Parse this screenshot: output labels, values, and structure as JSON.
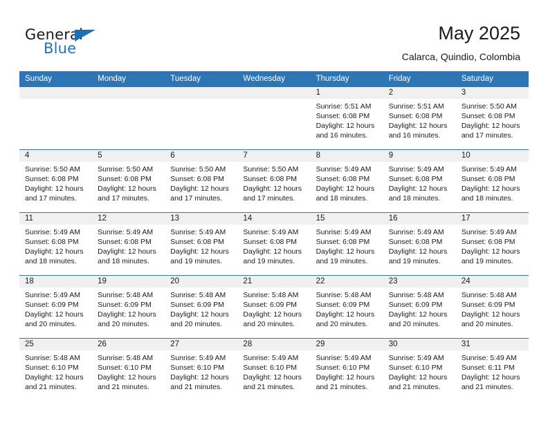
{
  "brand": {
    "name_top": "General",
    "name_bottom": "Blue",
    "accent_color": "#2272b8"
  },
  "header": {
    "title": "May 2025",
    "location": "Calarca, Quindio, Colombia"
  },
  "calendar": {
    "header_bg": "#2e75b6",
    "daynum_bg": "#f0f0f0",
    "weekday_headers": [
      "Sunday",
      "Monday",
      "Tuesday",
      "Wednesday",
      "Thursday",
      "Friday",
      "Saturday"
    ],
    "weeks": [
      [
        {
          "day": "",
          "empty": true
        },
        {
          "day": "",
          "empty": true
        },
        {
          "day": "",
          "empty": true
        },
        {
          "day": "",
          "empty": true
        },
        {
          "day": "1",
          "sunrise": "Sunrise: 5:51 AM",
          "sunset": "Sunset: 6:08 PM",
          "daylight": "Daylight: 12 hours and 16 minutes."
        },
        {
          "day": "2",
          "sunrise": "Sunrise: 5:51 AM",
          "sunset": "Sunset: 6:08 PM",
          "daylight": "Daylight: 12 hours and 16 minutes."
        },
        {
          "day": "3",
          "sunrise": "Sunrise: 5:50 AM",
          "sunset": "Sunset: 6:08 PM",
          "daylight": "Daylight: 12 hours and 17 minutes."
        }
      ],
      [
        {
          "day": "4",
          "sunrise": "Sunrise: 5:50 AM",
          "sunset": "Sunset: 6:08 PM",
          "daylight": "Daylight: 12 hours and 17 minutes."
        },
        {
          "day": "5",
          "sunrise": "Sunrise: 5:50 AM",
          "sunset": "Sunset: 6:08 PM",
          "daylight": "Daylight: 12 hours and 17 minutes."
        },
        {
          "day": "6",
          "sunrise": "Sunrise: 5:50 AM",
          "sunset": "Sunset: 6:08 PM",
          "daylight": "Daylight: 12 hours and 17 minutes."
        },
        {
          "day": "7",
          "sunrise": "Sunrise: 5:50 AM",
          "sunset": "Sunset: 6:08 PM",
          "daylight": "Daylight: 12 hours and 17 minutes."
        },
        {
          "day": "8",
          "sunrise": "Sunrise: 5:49 AM",
          "sunset": "Sunset: 6:08 PM",
          "daylight": "Daylight: 12 hours and 18 minutes."
        },
        {
          "day": "9",
          "sunrise": "Sunrise: 5:49 AM",
          "sunset": "Sunset: 6:08 PM",
          "daylight": "Daylight: 12 hours and 18 minutes."
        },
        {
          "day": "10",
          "sunrise": "Sunrise: 5:49 AM",
          "sunset": "Sunset: 6:08 PM",
          "daylight": "Daylight: 12 hours and 18 minutes."
        }
      ],
      [
        {
          "day": "11",
          "sunrise": "Sunrise: 5:49 AM",
          "sunset": "Sunset: 6:08 PM",
          "daylight": "Daylight: 12 hours and 18 minutes."
        },
        {
          "day": "12",
          "sunrise": "Sunrise: 5:49 AM",
          "sunset": "Sunset: 6:08 PM",
          "daylight": "Daylight: 12 hours and 18 minutes."
        },
        {
          "day": "13",
          "sunrise": "Sunrise: 5:49 AM",
          "sunset": "Sunset: 6:08 PM",
          "daylight": "Daylight: 12 hours and 19 minutes."
        },
        {
          "day": "14",
          "sunrise": "Sunrise: 5:49 AM",
          "sunset": "Sunset: 6:08 PM",
          "daylight": "Daylight: 12 hours and 19 minutes."
        },
        {
          "day": "15",
          "sunrise": "Sunrise: 5:49 AM",
          "sunset": "Sunset: 6:08 PM",
          "daylight": "Daylight: 12 hours and 19 minutes."
        },
        {
          "day": "16",
          "sunrise": "Sunrise: 5:49 AM",
          "sunset": "Sunset: 6:08 PM",
          "daylight": "Daylight: 12 hours and 19 minutes."
        },
        {
          "day": "17",
          "sunrise": "Sunrise: 5:49 AM",
          "sunset": "Sunset: 6:08 PM",
          "daylight": "Daylight: 12 hours and 19 minutes."
        }
      ],
      [
        {
          "day": "18",
          "sunrise": "Sunrise: 5:49 AM",
          "sunset": "Sunset: 6:09 PM",
          "daylight": "Daylight: 12 hours and 20 minutes."
        },
        {
          "day": "19",
          "sunrise": "Sunrise: 5:48 AM",
          "sunset": "Sunset: 6:09 PM",
          "daylight": "Daylight: 12 hours and 20 minutes."
        },
        {
          "day": "20",
          "sunrise": "Sunrise: 5:48 AM",
          "sunset": "Sunset: 6:09 PM",
          "daylight": "Daylight: 12 hours and 20 minutes."
        },
        {
          "day": "21",
          "sunrise": "Sunrise: 5:48 AM",
          "sunset": "Sunset: 6:09 PM",
          "daylight": "Daylight: 12 hours and 20 minutes."
        },
        {
          "day": "22",
          "sunrise": "Sunrise: 5:48 AM",
          "sunset": "Sunset: 6:09 PM",
          "daylight": "Daylight: 12 hours and 20 minutes."
        },
        {
          "day": "23",
          "sunrise": "Sunrise: 5:48 AM",
          "sunset": "Sunset: 6:09 PM",
          "daylight": "Daylight: 12 hours and 20 minutes."
        },
        {
          "day": "24",
          "sunrise": "Sunrise: 5:48 AM",
          "sunset": "Sunset: 6:09 PM",
          "daylight": "Daylight: 12 hours and 20 minutes."
        }
      ],
      [
        {
          "day": "25",
          "sunrise": "Sunrise: 5:48 AM",
          "sunset": "Sunset: 6:10 PM",
          "daylight": "Daylight: 12 hours and 21 minutes."
        },
        {
          "day": "26",
          "sunrise": "Sunrise: 5:48 AM",
          "sunset": "Sunset: 6:10 PM",
          "daylight": "Daylight: 12 hours and 21 minutes."
        },
        {
          "day": "27",
          "sunrise": "Sunrise: 5:49 AM",
          "sunset": "Sunset: 6:10 PM",
          "daylight": "Daylight: 12 hours and 21 minutes."
        },
        {
          "day": "28",
          "sunrise": "Sunrise: 5:49 AM",
          "sunset": "Sunset: 6:10 PM",
          "daylight": "Daylight: 12 hours and 21 minutes."
        },
        {
          "day": "29",
          "sunrise": "Sunrise: 5:49 AM",
          "sunset": "Sunset: 6:10 PM",
          "daylight": "Daylight: 12 hours and 21 minutes."
        },
        {
          "day": "30",
          "sunrise": "Sunrise: 5:49 AM",
          "sunset": "Sunset: 6:10 PM",
          "daylight": "Daylight: 12 hours and 21 minutes."
        },
        {
          "day": "31",
          "sunrise": "Sunrise: 5:49 AM",
          "sunset": "Sunset: 6:11 PM",
          "daylight": "Daylight: 12 hours and 21 minutes."
        }
      ]
    ]
  }
}
